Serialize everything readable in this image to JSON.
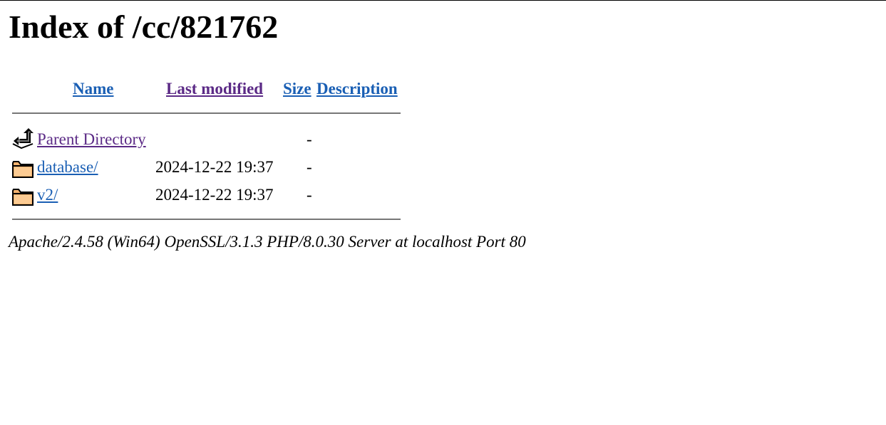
{
  "page": {
    "title": "Index of /cc/821762"
  },
  "table": {
    "headers": {
      "name": "Name",
      "last_modified": "Last modified",
      "size": "Size",
      "description": "Description"
    },
    "rows": [
      {
        "icon": "back-icon",
        "name": "Parent Directory",
        "last_modified": "",
        "size": "-",
        "description": ""
      },
      {
        "icon": "folder-icon",
        "name": "database/",
        "last_modified": "2024-12-22 19:37",
        "size": "-",
        "description": ""
      },
      {
        "icon": "folder-icon",
        "name": "v2/",
        "last_modified": "2024-12-22 19:37",
        "size": "-",
        "description": ""
      }
    ]
  },
  "footer": {
    "address": "Apache/2.4.58 (Win64) OpenSSL/3.1.3 PHP/8.0.30 Server at localhost Port 80"
  },
  "colors": {
    "link": "#1a5fb4",
    "visited_link": "#5b2a86",
    "rule": "#777777"
  }
}
